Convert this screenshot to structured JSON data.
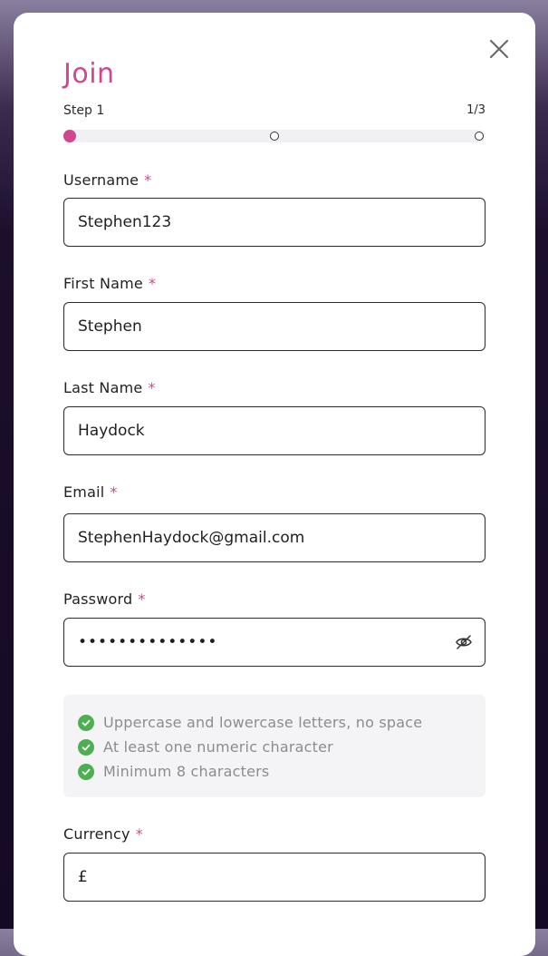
{
  "modal": {
    "title": "Join",
    "step_label": "Step 1",
    "step_count": "1/3",
    "progress": {
      "current_step": 1,
      "total_steps": 3
    },
    "accent_color": "#d0478f"
  },
  "fields": {
    "username": {
      "label": "Username",
      "value": "Stephen123",
      "required_mark": "*"
    },
    "first_name": {
      "label": "First Name",
      "value": "Stephen",
      "required_mark": "*"
    },
    "last_name": {
      "label": "Last Name",
      "value": "Haydock",
      "required_mark": "*"
    },
    "email": {
      "label": "Email",
      "value": "StephenHaydock@gmail.com",
      "required_mark": "*"
    },
    "password": {
      "label": "Password",
      "value": "••••••••••••••",
      "required_mark": "*",
      "toggle_icon": "eye-off-icon"
    },
    "currency": {
      "label": "Currency",
      "value": "£",
      "required_mark": "*"
    }
  },
  "password_rules": [
    {
      "text": "Uppercase and lowercase letters, no space",
      "met": true
    },
    {
      "text": "At least one numeric character",
      "met": true
    },
    {
      "text": "Minimum 8 characters",
      "met": true
    }
  ],
  "icons": {
    "close": "close-icon",
    "check": "check-circle-icon"
  }
}
